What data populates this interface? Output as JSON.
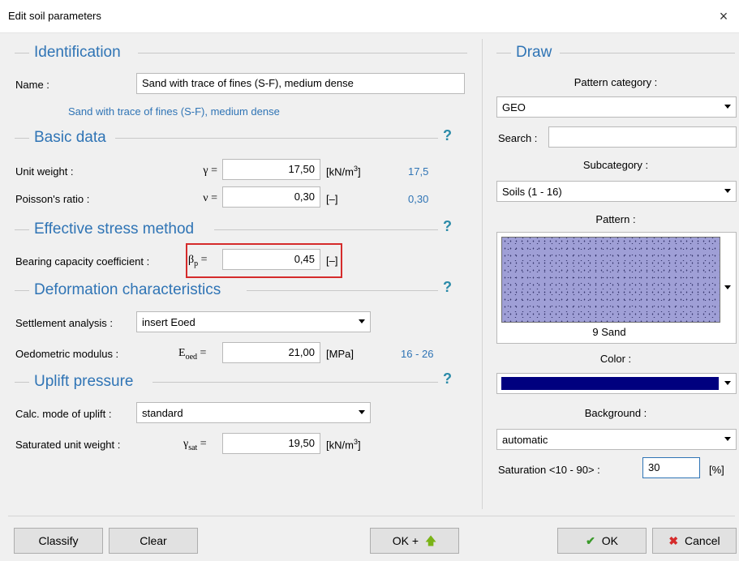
{
  "window": {
    "title": "Edit soil parameters",
    "close": "×"
  },
  "identification": {
    "section": "Identification",
    "name_label": "Name :",
    "name_value": "Sand with trace of fines (S-F), medium dense",
    "name_hint": "Sand with trace of fines (S-F), medium dense"
  },
  "basic": {
    "section": "Basic data",
    "help": "?",
    "unit_weight": {
      "label": "Unit weight :",
      "symbol": "γ =",
      "value": "17,50",
      "unit": "[kN/m",
      "unit_sup": "3",
      "unit_end": "]",
      "ref": "17,5"
    },
    "poisson": {
      "label": "Poisson's ratio :",
      "symbol": "ν =",
      "value": "0,30",
      "unit": "[–]",
      "ref": "0,30"
    }
  },
  "effective": {
    "section": "Effective stress method",
    "help": "?",
    "bearing": {
      "label": "Bearing capacity coefficient :",
      "symbol": "β",
      "symbol_sub": "p",
      "symbol_eq": " =",
      "value": "0,45",
      "unit": "[–]"
    }
  },
  "deformation": {
    "section": "Deformation characteristics",
    "help": "?",
    "settlement": {
      "label": "Settlement analysis :",
      "value": "insert Eoed"
    },
    "oedometric": {
      "label": "Oedometric modulus :",
      "symbol": "E",
      "symbol_sub": "oed",
      "symbol_eq": " =",
      "value": "21,00",
      "unit": "[MPa]",
      "ref": "16 - 26"
    }
  },
  "uplift": {
    "section": "Uplift pressure",
    "help": "?",
    "calc_mode": {
      "label": "Calc. mode of uplift :",
      "value": "standard"
    },
    "saturated": {
      "label": "Saturated unit weight :",
      "symbol": "γ",
      "symbol_sub": "sat",
      "symbol_eq": " =",
      "value": "19,50",
      "unit": "[kN/m",
      "unit_sup": "3",
      "unit_end": "]"
    }
  },
  "draw": {
    "section": "Draw",
    "pattern_category_label": "Pattern category :",
    "pattern_category_value": "GEO",
    "search_label": "Search :",
    "search_value": "",
    "subcategory_label": "Subcategory :",
    "subcategory_value": "Soils (1 - 16)",
    "pattern_label": "Pattern :",
    "pattern_name": "9 Sand",
    "pattern_fill": "#9f9fd6",
    "color_label": "Color :",
    "color_value": "#00007f",
    "background_label": "Background :",
    "background_value": "automatic",
    "saturation_label": "Saturation <10 - 90> :",
    "saturation_value": "30",
    "saturation_unit": "[%]"
  },
  "buttons": {
    "classify": "Classify",
    "clear": "Clear",
    "ok_plus": "OK +",
    "ok": "OK",
    "cancel": "Cancel"
  }
}
